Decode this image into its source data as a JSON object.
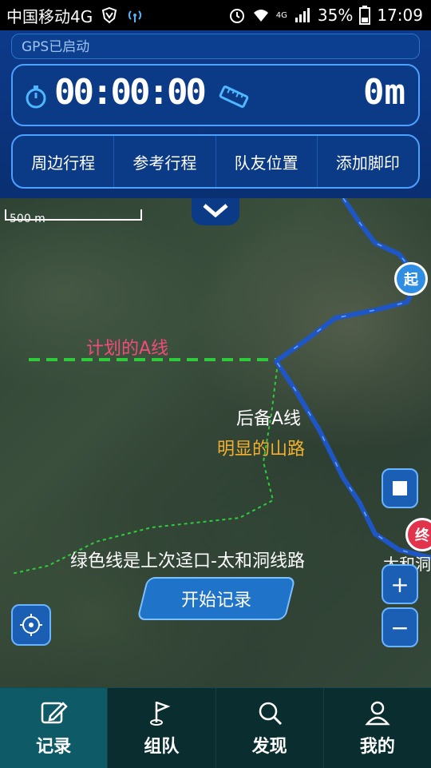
{
  "status_bar": {
    "carrier": "中国移动4G",
    "signal_tag": "4G",
    "battery": "35%",
    "time": "17:09"
  },
  "gps_status": "GPS已启动",
  "tracker": {
    "elapsed": "00:00:00",
    "distance": "0m"
  },
  "top_tabs": [
    "周边行程",
    "参考行程",
    "队友位置",
    "添加脚印"
  ],
  "map": {
    "scale_label": "500 m",
    "labels": {
      "planned_line": "计划的A线",
      "backup_line": "后备A线",
      "obvious_road": "明显的山路",
      "note": "绿色线是上次迳口-太和洞线路",
      "end_place": "太和洞"
    },
    "start_marker": "起",
    "end_marker": "终",
    "zoom_in": "+",
    "zoom_out": "−"
  },
  "start_record_button": "开始记录",
  "bottom_nav": [
    {
      "label": "记录",
      "icon": "edit-icon",
      "active": true
    },
    {
      "label": "组队",
      "icon": "flag-icon",
      "active": false
    },
    {
      "label": "发现",
      "icon": "search-icon",
      "active": false
    },
    {
      "label": "我的",
      "icon": "user-icon",
      "active": false
    }
  ],
  "colors": {
    "panel_blue": "#0b3a86",
    "route_blue": "#1f56c6",
    "green_line": "#2ecc3a",
    "plan_label": "#f14c7c",
    "road_label": "#f3b02d"
  }
}
